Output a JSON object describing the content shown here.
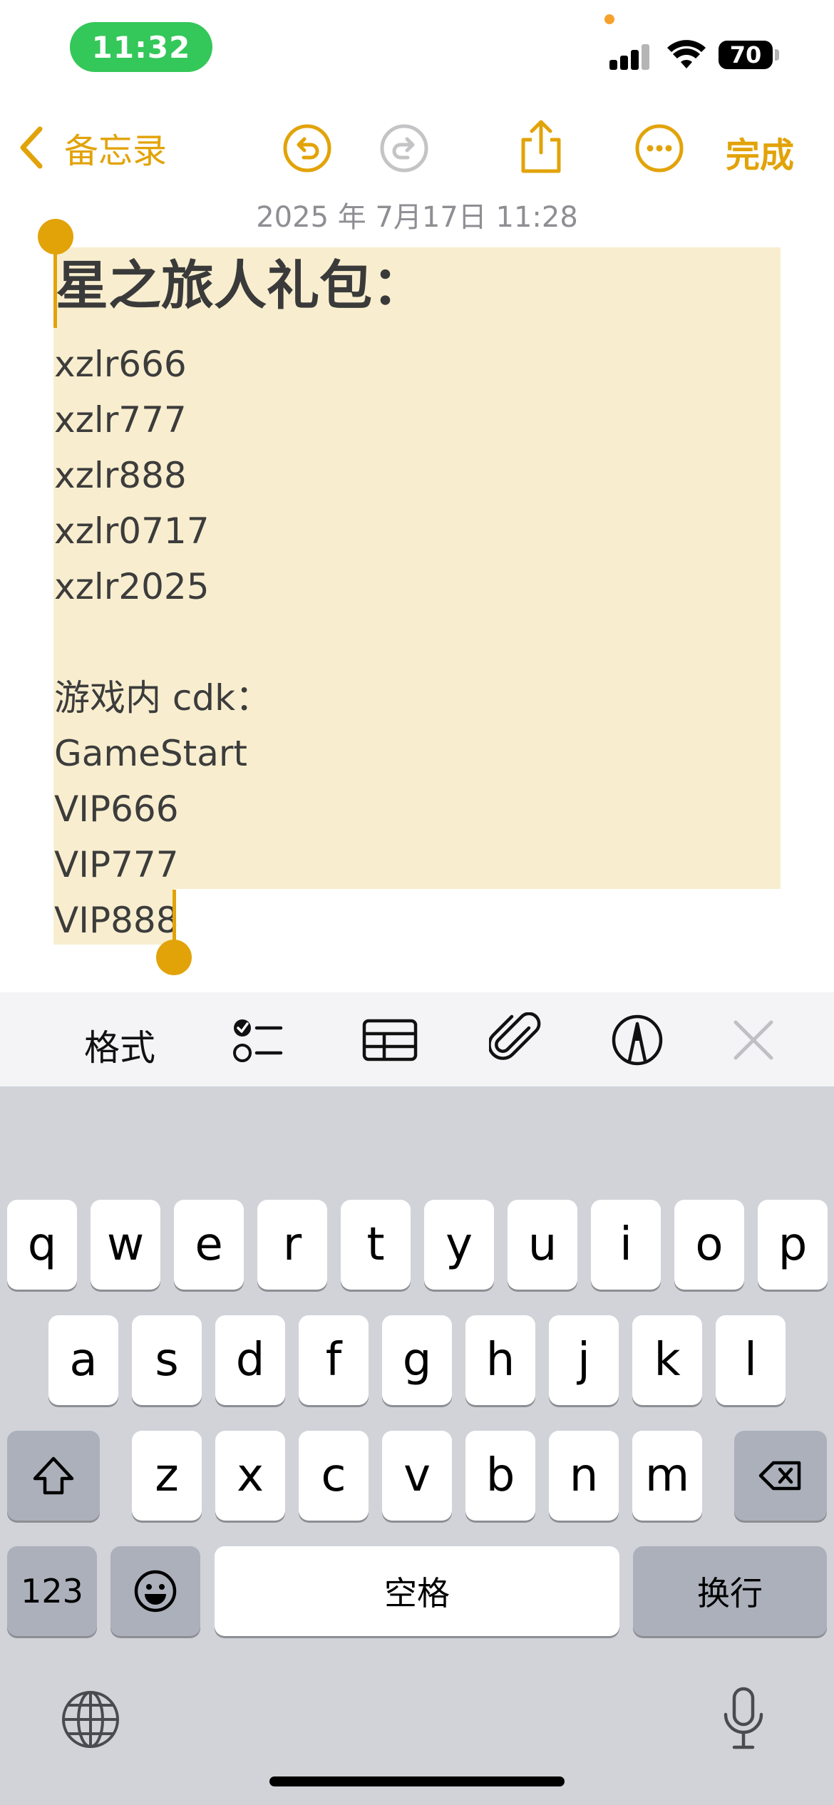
{
  "status_bar": {
    "time": "11:32",
    "battery": "70"
  },
  "nav": {
    "back_label": "备忘录",
    "done_label": "完成",
    "icons": [
      "chevron-left-icon",
      "undo-icon",
      "redo-icon",
      "share-icon",
      "more-icon"
    ]
  },
  "note": {
    "date": "2025 年 7月17日 11:28",
    "title": "星之旅人礼包：",
    "lines": [
      "xzlr666",
      "xzlr777",
      "xzlr888",
      "xzlr0717",
      "xzlr2025",
      "",
      "游戏内 cdk：",
      "GameStart",
      "VIP666",
      "VIP777",
      "VIP888"
    ]
  },
  "toolbar": {
    "format_label": "格式",
    "icons": [
      "checklist-icon",
      "table-icon",
      "attachment-icon",
      "markup-icon",
      "close-icon"
    ]
  },
  "keyboard": {
    "row1": [
      "q",
      "w",
      "e",
      "r",
      "t",
      "y",
      "u",
      "i",
      "o",
      "p"
    ],
    "row2": [
      "a",
      "s",
      "d",
      "f",
      "g",
      "h",
      "j",
      "k",
      "l"
    ],
    "row3": [
      "z",
      "x",
      "c",
      "v",
      "b",
      "n",
      "m"
    ],
    "numbers_label": "123",
    "space_label": "空格",
    "return_label": "换行"
  },
  "colors": {
    "accent": "#e2a309",
    "highlight": "#f8eecf",
    "keyboard_bg": "#d1d3d9",
    "time_pill": "#34c759"
  }
}
